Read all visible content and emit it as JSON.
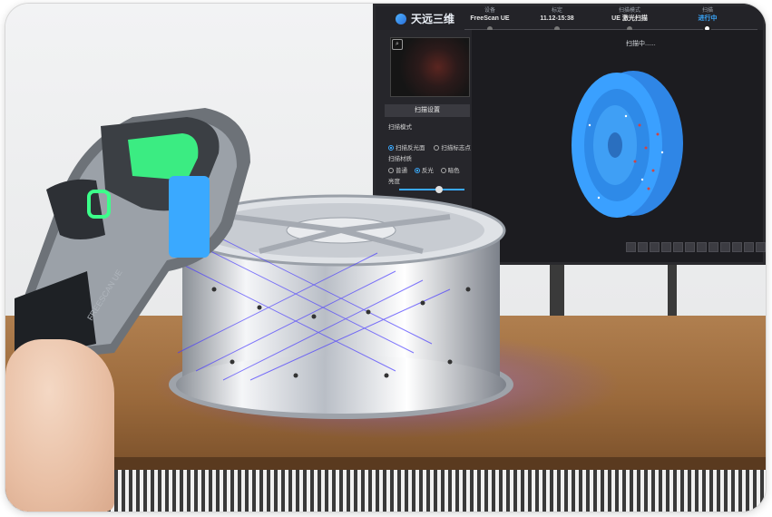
{
  "monitor": {
    "logo_text": "天远三维",
    "steps": [
      {
        "key": "设备",
        "value": "FreeScan UE"
      },
      {
        "key": "标定",
        "value": "11.12-15:38"
      },
      {
        "key": "扫描模式",
        "value": "UE 激光扫描"
      },
      {
        "key": "扫描",
        "value": "进行中"
      }
    ],
    "status_text": "扫描中......",
    "panel": {
      "title": "扫描设置",
      "mode_label": "扫描模式",
      "mode_option_1": "扫描反光面",
      "mode_option_2": "扫描标志点",
      "object_label": "扫描材质",
      "object_options": [
        "普通",
        "反光",
        "暗色"
      ],
      "brightness_label": "亮度"
    }
  },
  "scene": {
    "scanner_label": "FREESCAN UE",
    "accent_color": "#3aa9ff",
    "scanner_light_color": "#3cff8a",
    "laser_color": "#5a4bff"
  }
}
